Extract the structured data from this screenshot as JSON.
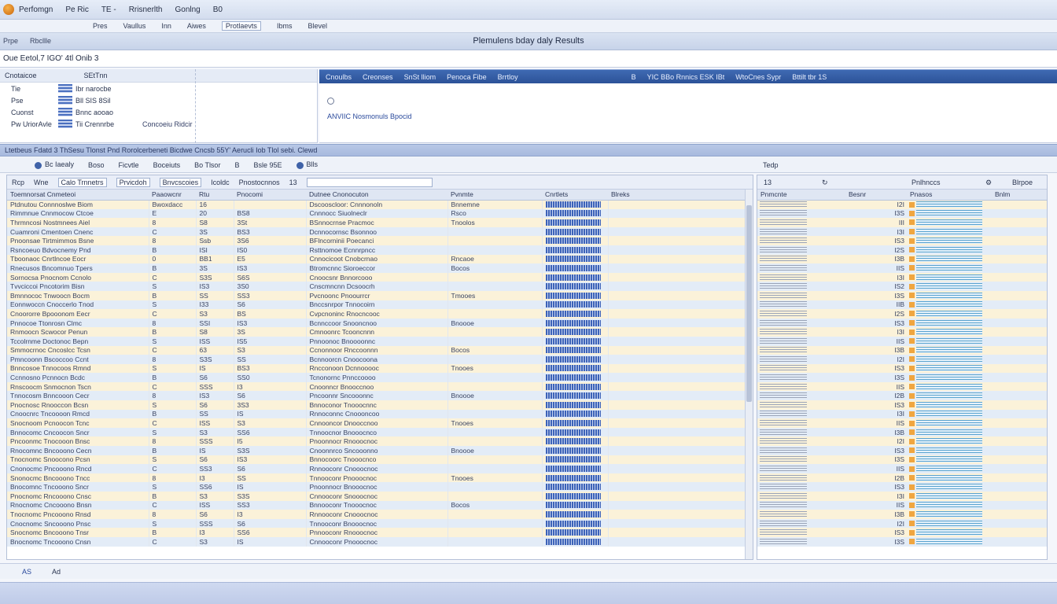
{
  "menubar": {
    "items": [
      "Perfomgn",
      "Pe Ric",
      "TE -",
      "Rrisnerlth",
      "Gonlng",
      "B0"
    ]
  },
  "toolbar": {
    "items": [
      "Pres",
      "Vaullus",
      "Inn",
      "Aiwes",
      "Protlaevts",
      "Ibms",
      "Blevel"
    ]
  },
  "titlebar": {
    "left": [
      "Prpe",
      "Rbcllle"
    ],
    "title": "Plemulens bday daly Results"
  },
  "query": {
    "text": "Oue  Eetol,7 IGO' 4tl Onib 3"
  },
  "upper_left": {
    "header": [
      "Cnotaicoe",
      "SEtTnn"
    ],
    "rows": [
      {
        "k": "Tie",
        "v": "Ibr narocbe",
        "x": ""
      },
      {
        "k": "Pse",
        "v": "Bll SIS 8Sil",
        "x": ""
      },
      {
        "k": "Cuonst",
        "v": "Bnnc aooao",
        "x": ""
      },
      {
        "k": "Pw UriorAvle",
        "v": "Tii Crennrbe",
        "x": "Concoeiu Ridcir"
      }
    ]
  },
  "upper_right": {
    "header": [
      "Cnoulbs",
      "Creonses",
      "SnSt lliom",
      "Penoca Fibe",
      "Brrtloy",
      "B",
      "YIC BBo Rnnics ESK IBt",
      "WtoCnes Sypr",
      "Bttilt tbr 1S"
    ],
    "link": "ANVIIC Nosmonuls Bpocid"
  },
  "strip": {
    "text": "Ltetbeus  Fdatd 3 ThSesu Tlonst Pnd Rorolcerbeneti Bicdwe Cncsb 55Y' Aerucli Iob Tlol sebi. Clewd"
  },
  "filterbar": {
    "items": [
      "Bc Iaealy",
      "Boso",
      "Ficvtle",
      "Boceiuts",
      "Bo Tlsor",
      "B",
      "Bsle 95E",
      "Blls"
    ],
    "help": "Tedp"
  },
  "grid": {
    "toolbar": [
      "Rcp",
      "Wne",
      "Calo Trnnetrs",
      "Prvicdoh",
      "Bnvcscoies",
      "Icoldc",
      "Pnostocnnos",
      "13"
    ],
    "columns": [
      "Toemnorsat Cnmeteoi",
      "Paaowcnr",
      "Rtu",
      "Pnocomi",
      "Dutnee Cnonocuton",
      "Pvnmte",
      "Cnrtlets",
      "Blreks"
    ],
    "rows": [
      [
        "Ptdnutou Connnoslwe Biom",
        "Bwoxdacc",
        "16",
        "",
        "Dscooscloor: Cnnnonoln",
        "Bnnemne",
        "",
        ""
      ],
      [
        "Rimmnue Cnnmocow Ctcoe",
        "E",
        "20",
        "BS8",
        "Cnnnocc Siuolneclr",
        "Rsco",
        "",
        ""
      ],
      [
        "Thrmncosi Nostmnees Aiel",
        "8",
        "S8",
        "3St",
        "BSnnocrnse Pracmoc",
        "Tnoolos",
        "",
        ""
      ],
      [
        "Cuamroni Cmentoen Cnenc",
        "C",
        "3S",
        "BS3",
        "Dcnnocornsc Bsonnoo",
        "",
        "",
        ""
      ],
      [
        "Pnoonsae Tirtmimmos Bsne",
        "8",
        "Ssb",
        "3S6",
        "BFlncorninii Poecanci",
        "",
        "",
        ""
      ],
      [
        "Rsncoeuo Bdvocnemy Pnd",
        "B",
        "ISI",
        "IS0",
        "Rsttnomoe Ecnnrpncc",
        "",
        "",
        ""
      ],
      [
        "Tboonaoc Cnrtlncoe Eocr",
        "0",
        "BB1",
        "E5",
        "Cnnocicoot Cnobcrnao",
        "Rncaoe",
        "",
        ""
      ],
      [
        "Rnecusos Bncomnuo Tpers",
        "B",
        "3S",
        "IS3",
        "Btromcnnc Sioroeccor",
        "Bocos",
        "",
        ""
      ],
      [
        "Sornocsa Pnocnom Ccnolo",
        "C",
        "S3S",
        "S6S",
        "Cnoocsnr Bnnorcooo",
        "",
        "",
        ""
      ],
      [
        "Tvvciccoi Pncotorim Bisn",
        "S",
        "IS3",
        "3S0",
        "Cnscmncnn Dcsoocrh",
        "",
        "",
        ""
      ],
      [
        "Bmnnococ Tnwoocn Bocm",
        "B",
        "SS",
        "SS3",
        "Pvcnoonc Pnoourrcr",
        "Tmooes",
        "",
        ""
      ],
      [
        "Eonnwoccn Cnoccerlo Tnod",
        "S",
        "I33",
        "S6",
        "Bnccsnrpor Tnnocoirn",
        "",
        "",
        ""
      ],
      [
        "Cnoororre Bpooonom Eecr",
        "C",
        "S3",
        "BS",
        "Cvpcnoninc Rnocncooc",
        "",
        "",
        ""
      ],
      [
        "Pnnocoe Ttonrosn Clmc",
        "8",
        "SSI",
        "IS3",
        "Bcnnccoor Snooncnoo",
        "Bnoooe",
        "",
        ""
      ],
      [
        "Rnmoocn Scwocor Penun",
        "B",
        "S8",
        "3S",
        "Cmnoonrc Tcooncnnn",
        "",
        "",
        ""
      ],
      [
        "Tccolrnme Doctonoc Bepn",
        "S",
        "ISS",
        "IS5",
        "Pnnoonoc Bnoooonnc",
        "",
        "",
        ""
      ],
      [
        "Smmocrnoc Cncoslcc Tcsn",
        "C",
        "63",
        "S3",
        "Ccnonnoor Rnccoonnn",
        "Bocos",
        "",
        ""
      ],
      [
        "Pmncoonn Bscoccoo Ccnt",
        "8",
        "S3S",
        "SS",
        "Bcnnoorcn Cnoocoona",
        "",
        "",
        ""
      ],
      [
        "Bnncosoe Tnnocoos Rmnd",
        "S",
        "IS",
        "BS3",
        "Rncconoon Dcnnooooc",
        "Tnooes",
        "",
        ""
      ],
      [
        "Ccnnosno Pcnnocn Bcdc",
        "B",
        "S6",
        "SS0",
        "Tcnonornc Pnnccoooo",
        "",
        "",
        ""
      ],
      [
        "Rnscoocm Snmocnon Tscn",
        "C",
        "SSS",
        "I3",
        "Cnoonncr Bnooccnoo",
        "",
        "",
        ""
      ],
      [
        "Tnnocosm Bnncooon Cecr",
        "8",
        "IS3",
        "S6",
        "Pncoonnr Sncooonnc",
        "Bnoooe",
        "",
        ""
      ],
      [
        "Pnocnosc Rnooccon Bcsn",
        "S",
        "S6",
        "3S3",
        "Bnnoconor Tnooocnnc",
        "",
        "",
        ""
      ],
      [
        "Cnoocnrc Tncoooon Rmcd",
        "B",
        "SS",
        "IS",
        "Rnnoconnc Cnoooncoo",
        "",
        "",
        ""
      ],
      [
        "Snocnoom Pcnoocon Tcnc",
        "C",
        "ISS",
        "S3",
        "Cnnooncor Dnooccnoo",
        "Tnooes",
        "",
        ""
      ],
      [
        "Bnnocomc Cncoocon Sncr",
        "S",
        "S3",
        "SS6",
        "Tnnoocnor Bnooocnco",
        "",
        "",
        ""
      ],
      [
        "Pncoonmc Tnocooon Bnsc",
        "8",
        "SSS",
        "I5",
        "Pnoonnocr Rnooocnoc",
        "",
        "",
        ""
      ],
      [
        "Rnocomnc Bncooono Cecn",
        "B",
        "IS",
        "S3S",
        "Cnoonnrco Sncooonno",
        "Bnoooe",
        "",
        ""
      ],
      [
        "Tnocnomc Snoocono Pcsn",
        "S",
        "S6",
        "IS3",
        "Bnnocoorc Tnooocnco",
        "",
        "",
        ""
      ],
      [
        "Cnonocmc Pncooono Rncd",
        "C",
        "SS3",
        "S6",
        "Rnnooconr Cnooocnoc",
        "",
        "",
        ""
      ],
      [
        "Snonocmc Bncooono Tncc",
        "8",
        "I3",
        "SS",
        "Tnnooconr Pnooocnoc",
        "Tnooes",
        "",
        ""
      ],
      [
        "Bnocomnc Tncooono Sncr",
        "S",
        "SS6",
        "IS",
        "Pnoonnocr Bnooocnoc",
        "",
        "",
        ""
      ],
      [
        "Pnocnomc Rncooono Cnsc",
        "B",
        "S3",
        "S3S",
        "Cnnooconr Snooocnoc",
        "",
        "",
        ""
      ],
      [
        "Rnocnomc Cncooono Bnsn",
        "C",
        "ISS",
        "SS3",
        "Bnnooconr Tnooocnoc",
        "Bocos",
        "",
        ""
      ],
      [
        "Tnocnomc Pncooono Rnsd",
        "8",
        "S6",
        "I3",
        "Rnnooconr Cnooocnoc",
        "",
        "",
        ""
      ],
      [
        "Cnocnomc Sncooono Pnsc",
        "S",
        "SSS",
        "S6",
        "Tnnooconr Bnooocnoc",
        "",
        "",
        ""
      ],
      [
        "Snocnomc Bncooono Tnsr",
        "B",
        "I3",
        "SS6",
        "Pnnooconr Rnooocnoc",
        "",
        "",
        ""
      ],
      [
        "Bnocnomc Tncooono Cnsn",
        "C",
        "S3",
        "IS",
        "Cnnooconr Pnooocnoc",
        "",
        "",
        ""
      ]
    ]
  },
  "rgrid": {
    "toolbar": [
      "13",
      "Pnlhnccs",
      "Blrpoe"
    ],
    "columns": [
      "Pnmcnte",
      "Besnr",
      "Pnasos",
      "Bnlm"
    ],
    "rows_count": 38,
    "row_labels": [
      "I2I",
      "I3S",
      "III",
      "I3I",
      "IS3",
      "I2S",
      "I3B",
      "IIS",
      "I3I",
      "IS2",
      "I3S",
      "IIB",
      "I2S",
      "IS3",
      "I3I",
      "IIS",
      "I3B",
      "I2I",
      "IS3",
      "I3S",
      "IIS",
      "I2B",
      "IS3",
      "I3I",
      "IIS",
      "I3B",
      "I2I",
      "IS3",
      "I3S",
      "IIS",
      "I2B",
      "IS3",
      "I3I",
      "IIS",
      "I3B",
      "I2I",
      "IS3",
      "I3S"
    ]
  },
  "bottombar": {
    "items": [
      "AS",
      "Ad"
    ]
  }
}
